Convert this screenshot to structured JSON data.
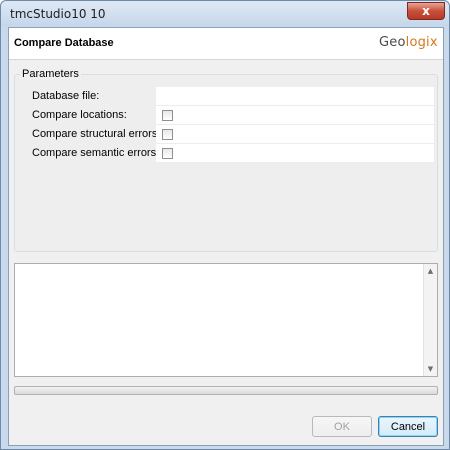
{
  "window": {
    "title": "tmcStudio10 10",
    "close_glyph": "x"
  },
  "header": {
    "title": "Compare Database",
    "logo_text_main": "Geo",
    "logo_text_rest": "logix"
  },
  "parameters": {
    "group_label": "Parameters",
    "rows": [
      {
        "label": "Database file:",
        "type": "text",
        "value": ""
      },
      {
        "label": "Compare locations:",
        "type": "checkbox",
        "checked": false
      },
      {
        "label": "Compare structural errors:",
        "type": "checkbox",
        "checked": false
      },
      {
        "label": "Compare semantic errors:",
        "type": "checkbox",
        "checked": false
      }
    ]
  },
  "log": {
    "text": "",
    "scroll_up_glyph": "▲",
    "scroll_down_glyph": "▼"
  },
  "progress": {
    "percent": 0
  },
  "buttons": {
    "ok_label": "OK",
    "ok_enabled": false,
    "cancel_label": "Cancel"
  },
  "colors": {
    "progress_fill": "#37b44a",
    "logo_accent": "#d47a1a",
    "close_button": "#c7503b"
  }
}
